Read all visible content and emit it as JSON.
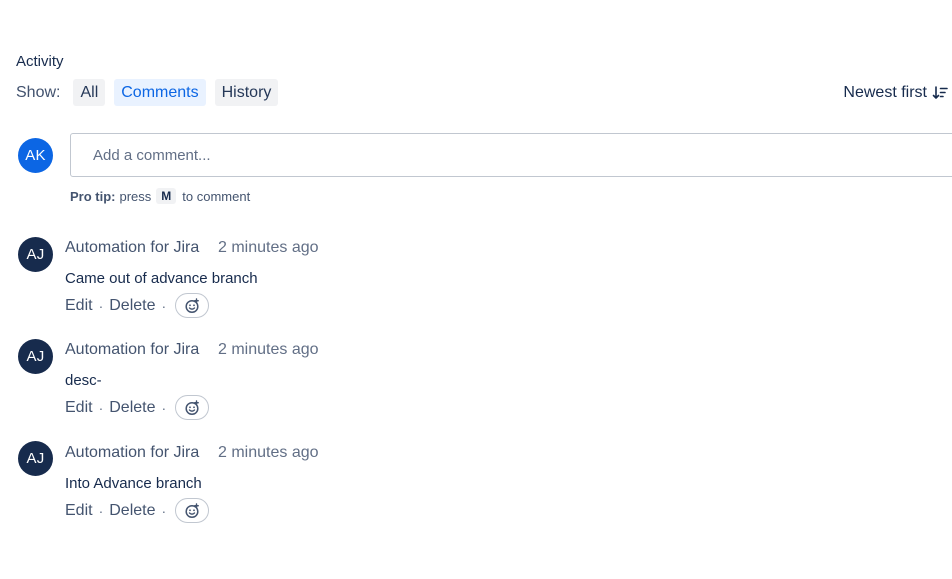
{
  "activity": {
    "title": "Activity",
    "show_label": "Show:",
    "filters": [
      {
        "label": "All",
        "active": false
      },
      {
        "label": "Comments",
        "active": true
      },
      {
        "label": "History",
        "active": false
      }
    ],
    "sort_label": "Newest first",
    "sort_icon": "sort-descending-icon"
  },
  "composer": {
    "avatar_initials": "AK",
    "placeholder": "Add a comment...",
    "pro_tip_label": "Pro tip:",
    "pro_tip_press": "press",
    "pro_tip_key": "M",
    "pro_tip_suffix": "to comment"
  },
  "comments": [
    {
      "avatar_initials": "AJ",
      "author": "Automation for Jira",
      "time": "2 minutes ago",
      "body": "Came out of advance branch",
      "edit_label": "Edit",
      "delete_label": "Delete",
      "separator": "·"
    },
    {
      "avatar_initials": "AJ",
      "author": "Automation for Jira",
      "time": "2 minutes ago",
      "body": "desc-",
      "edit_label": "Edit",
      "delete_label": "Delete",
      "separator": "·"
    },
    {
      "avatar_initials": "AJ",
      "author": "Automation for Jira",
      "time": "2 minutes ago",
      "body": "Into Advance branch",
      "edit_label": "Edit",
      "delete_label": "Delete",
      "separator": "·"
    }
  ],
  "colors": {
    "accent": "#0c66e4",
    "bot_avatar": "#172b4d",
    "active_filter_bg": "#e9f2ff"
  }
}
